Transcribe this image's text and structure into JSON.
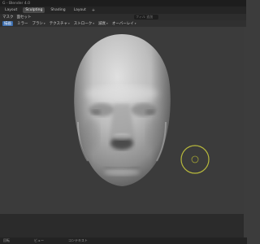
{
  "window": {
    "title": "G - Blender 4.0"
  },
  "workspaces": {
    "tabs": [
      {
        "label": "Layout"
      },
      {
        "label": "Sculpting",
        "active": true
      },
      {
        "label": "Shading"
      },
      {
        "label": "Layout"
      }
    ],
    "add_label": "+"
  },
  "mode_bar": {
    "items": [
      "マスク",
      "面セット"
    ],
    "search_placeholder": "フィル 追加"
  },
  "tool_header": {
    "items": [
      {
        "label": "描画",
        "active": true
      },
      {
        "label": "ミラー"
      },
      {
        "label": "ブラシ"
      },
      {
        "label": "テクスチャ"
      },
      {
        "label": "ストローク"
      },
      {
        "label": "減衰"
      },
      {
        "label": "オーバーレイ"
      }
    ]
  },
  "status_bar": {
    "items": [
      "回転",
      "ビュー",
      "コンテキスト"
    ]
  },
  "colors": {
    "accent": "#3d6fb0",
    "brush_cursor": "#b7b83c",
    "viewport_bg": "#3b3b3b"
  }
}
